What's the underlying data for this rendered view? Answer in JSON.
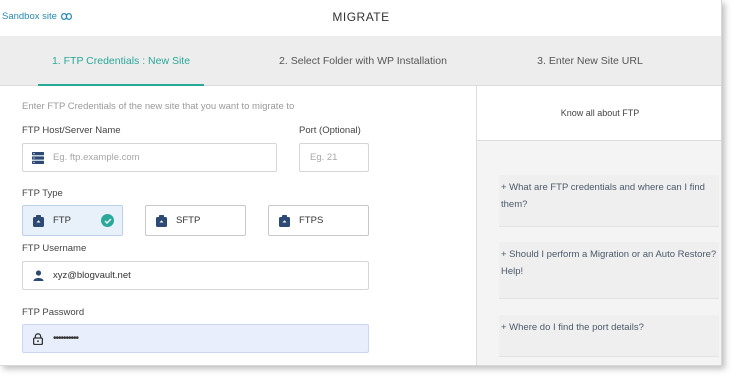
{
  "topbar": {
    "sandbox_label": "Sandbox site",
    "title": "MIGRATE"
  },
  "tabs": [
    {
      "label": "1. FTP Credentials : New Site",
      "active": true
    },
    {
      "label": "2. Select Folder with WP Installation",
      "active": false
    },
    {
      "label": "3. Enter New Site URL",
      "active": false
    }
  ],
  "form": {
    "intro": "Enter FTP Credentials of the new site that you want to migrate to",
    "host_label": "FTP Host/Server Name",
    "host_placeholder": "Eg. ftp.example.com",
    "port_label": "Port (Optional)",
    "port_placeholder": "Eg. 21",
    "type_label": "FTP Type",
    "types": [
      "FTP",
      "SFTP",
      "FTPS"
    ],
    "selected_type": "FTP",
    "username_label": "FTP Username",
    "username_value": "xyz@blogvault.net",
    "password_label": "FTP Password",
    "password_value": "••••••••••"
  },
  "help": {
    "heading": "Know all about FTP",
    "faqs": [
      "+ What are FTP credentials and where can I find them?",
      "+ Should I perform a Migration or an Auto Restore? Help!",
      "+ Where do I find the port details?"
    ]
  },
  "colors": {
    "accent": "#2aa899",
    "link": "#2a8ab0",
    "selected_bg": "#e8f0fa",
    "password_bg": "#e9eefc"
  },
  "icons": {
    "sandbox": "link-icon",
    "host": "server-icon",
    "type": "ftp-type-icon",
    "check": "check-circle-icon",
    "username": "user-icon",
    "password": "lock-icon"
  }
}
